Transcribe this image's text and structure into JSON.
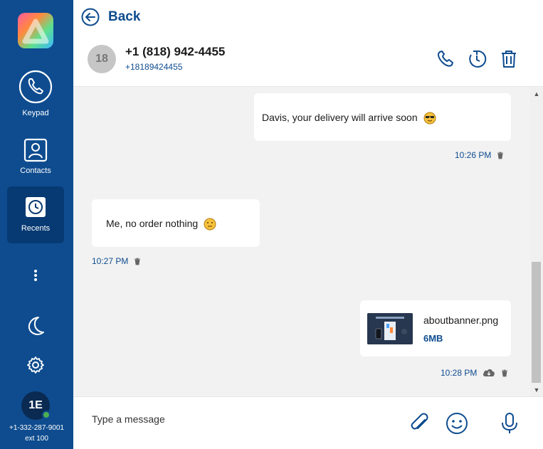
{
  "sidebar": {
    "items": [
      {
        "label": "Keypad",
        "icon": "phone-icon"
      },
      {
        "label": "Contacts",
        "icon": "contact-icon"
      },
      {
        "label": "Recents",
        "icon": "clock-icon",
        "active": true
      }
    ],
    "user": {
      "initials": "1E",
      "number": "+1-332-287-9001",
      "ext": "ext 100",
      "status_color": "#4caf50"
    }
  },
  "header": {
    "back_label": "Back"
  },
  "contact": {
    "avatar_text": "18",
    "title": "+1 (818) 942-4455",
    "subtitle": "+18189424455"
  },
  "messages": [
    {
      "direction": "outgoing",
      "text": "Davis, your delivery will arrive soon",
      "emoji": "sunglasses-emoji",
      "time": "10:26 PM"
    },
    {
      "direction": "incoming",
      "text": "Me, no order nothing",
      "emoji": "neutral-face-emoji",
      "time": "10:27 PM"
    },
    {
      "direction": "outgoing",
      "type": "file",
      "file_name": "aboutbanner.png",
      "file_size": "6MB",
      "time": "10:28 PM"
    }
  ],
  "composer": {
    "placeholder": "Type a message"
  },
  "colors": {
    "brand": "#0e4c8f",
    "sidebar_active": "#073a72",
    "background": "#f2f2f2"
  }
}
